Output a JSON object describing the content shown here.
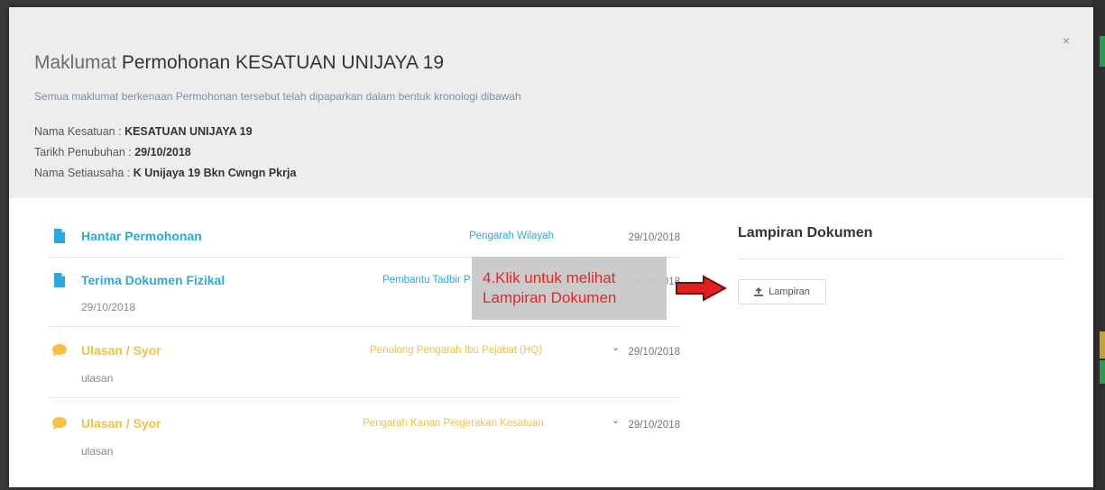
{
  "modal": {
    "title_prefix": "Maklumat",
    "title_main": "Permohonan KESATUAN UNIJAYA 19",
    "subtitle": "Semua maklumat berkenaan Permohonan tersebut telah dipaparkan dalam bentuk kronologi dibawah",
    "close_label": "×",
    "info": [
      {
        "label": "Nama Kesatuan : ",
        "value": "KESATUAN UNIJAYA 19"
      },
      {
        "label": "Tarikh Penubuhan : ",
        "value": "29/10/2018"
      },
      {
        "label": "Nama Setiausaha : ",
        "value": "K Unijaya 19 Bkn Cwngn Pkrja"
      }
    ]
  },
  "timeline": [
    {
      "title": "Hantar Permohonan",
      "who": "Pengarah Wilayah",
      "date": "29/10/2018",
      "desc": "",
      "icon": "document-icon",
      "has_chevron": false
    },
    {
      "title": "Terima Dokumen Fizikal",
      "who": "Pembantu Tadbir P",
      "date": "29/10/2018",
      "desc": "29/10/2018",
      "icon": "document-icon",
      "has_chevron": false
    },
    {
      "title": "Ulasan / Syor",
      "who": "Penolong Pengarah Ibu Pejabat (HQ)",
      "date": "29/10/2018",
      "desc": "ulasan",
      "icon": "comment-icon",
      "has_chevron": true,
      "chevron": "⌄"
    },
    {
      "title": "Ulasan / Syor",
      "who": "Pengarah Kanan Pergerakan Kesatuan",
      "date": "29/10/2018",
      "desc": "ulasan",
      "icon": "comment-icon",
      "has_chevron": true,
      "chevron": "⌄"
    }
  ],
  "attachments": {
    "title": "Lampiran Dokumen",
    "button_label": "Lampiran",
    "button_icon": "upload-icon"
  },
  "callout": {
    "line1": "4.Klik untuk melihat",
    "line2": "Lampiran Dokumen"
  },
  "colors": {
    "blue": "#2aa9e0",
    "yellow": "#f5c043",
    "callout_text": "#e01f1f",
    "arrow": "#e01f1f"
  }
}
